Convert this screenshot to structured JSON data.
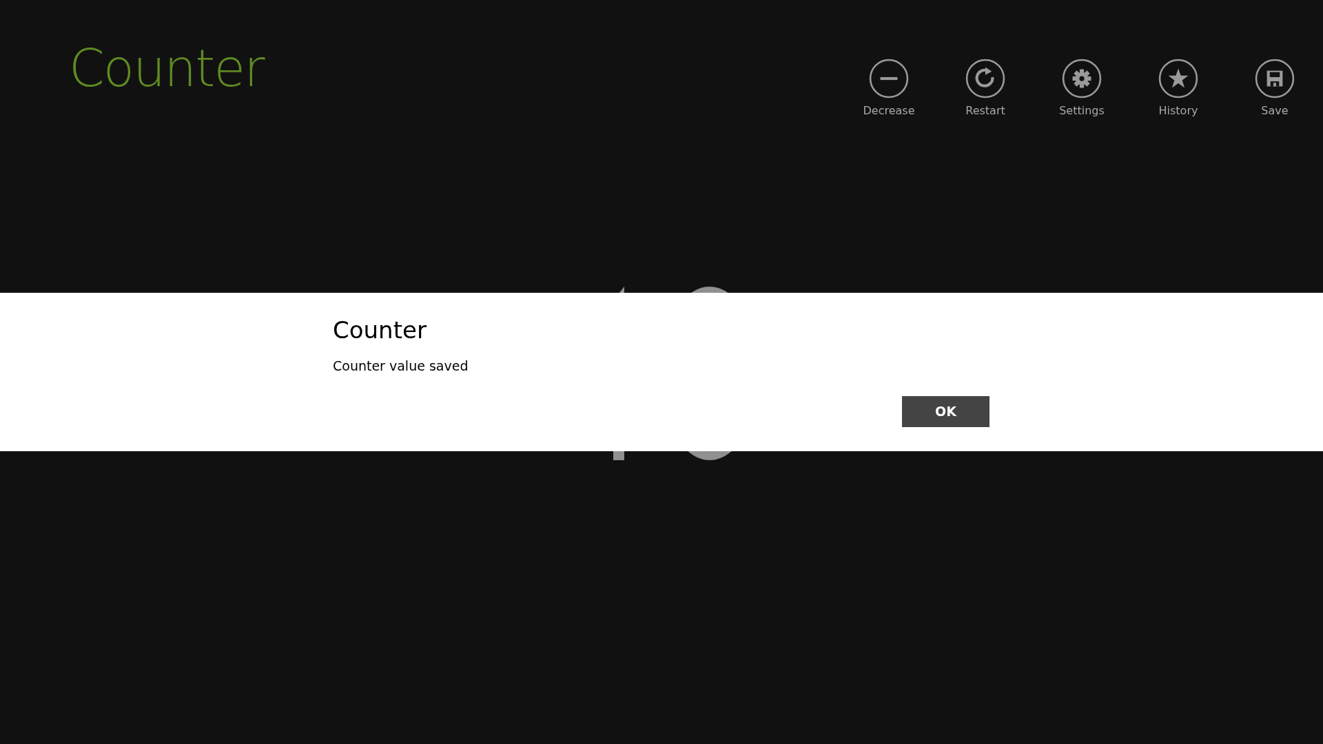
{
  "app": {
    "title": "Counter"
  },
  "app_bar": [
    {
      "kind": "minus",
      "label": "Decrease"
    },
    {
      "kind": "restart",
      "label": "Restart"
    },
    {
      "kind": "gear",
      "label": "Settings"
    },
    {
      "kind": "star",
      "label": "History"
    },
    {
      "kind": "save",
      "label": "Save"
    }
  ],
  "dialog": {
    "title": "Counter",
    "message": "Counter value saved",
    "buttons": [
      "OK"
    ]
  }
}
